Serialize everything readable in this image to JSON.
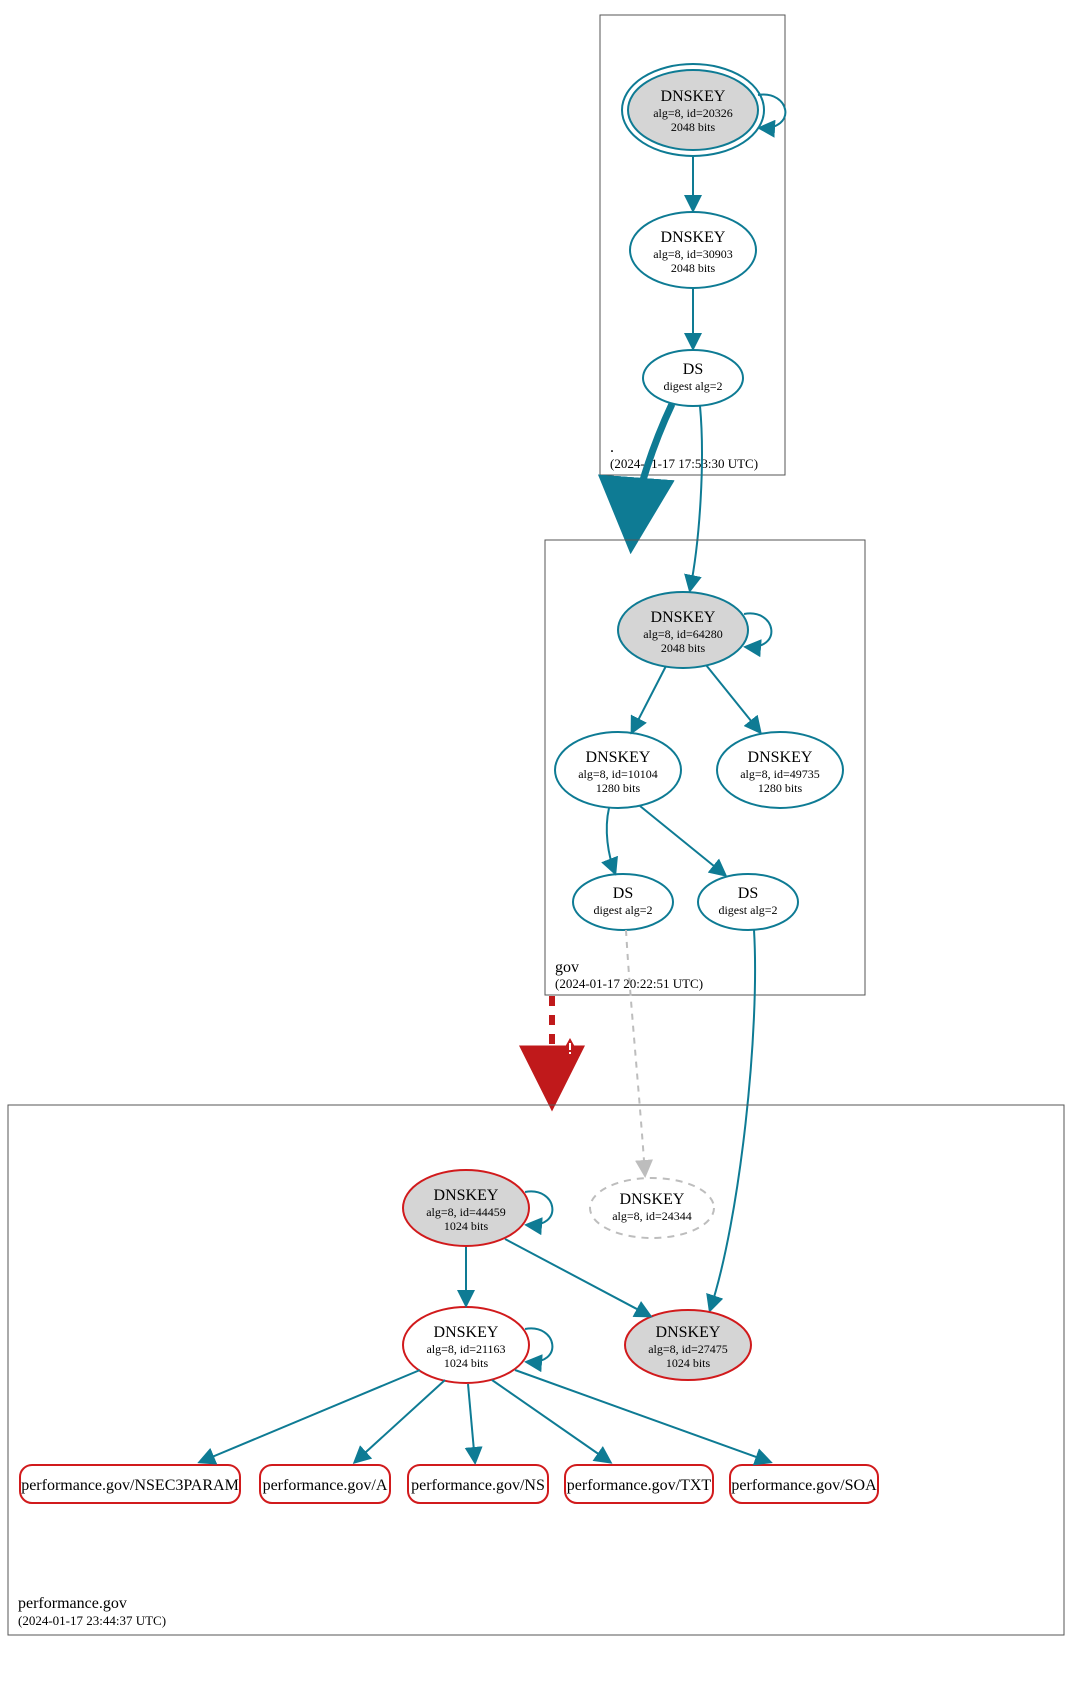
{
  "colors": {
    "teal": "#0e7b94",
    "red": "#d11a1c",
    "grayFill": "#d5d5d5",
    "boxStroke": "#555555",
    "dashedGray": "#bdbdbd"
  },
  "zones": {
    "root": {
      "name": ".",
      "timestamp": "(2024-01-17 17:53:30 UTC)"
    },
    "gov": {
      "name": "gov",
      "timestamp": "(2024-01-17 20:22:51 UTC)"
    },
    "perf": {
      "name": "performance.gov",
      "timestamp": "(2024-01-17 23:44:37 UTC)"
    }
  },
  "nodes": {
    "root_ksk": {
      "title": "DNSKEY",
      "line2": "alg=8, id=20326",
      "line3": "2048 bits"
    },
    "root_zsk": {
      "title": "DNSKEY",
      "line2": "alg=8, id=30903",
      "line3": "2048 bits"
    },
    "root_ds": {
      "title": "DS",
      "line2": "digest alg=2"
    },
    "gov_ksk": {
      "title": "DNSKEY",
      "line2": "alg=8, id=64280",
      "line3": "2048 bits"
    },
    "gov_zskL": {
      "title": "DNSKEY",
      "line2": "alg=8, id=10104",
      "line3": "1280 bits"
    },
    "gov_zskR": {
      "title": "DNSKEY",
      "line2": "alg=8, id=49735",
      "line3": "1280 bits"
    },
    "gov_dsL": {
      "title": "DS",
      "line2": "digest alg=2"
    },
    "gov_dsR": {
      "title": "DS",
      "line2": "digest alg=2"
    },
    "perf_ksk": {
      "title": "DNSKEY",
      "line2": "alg=8, id=44459",
      "line3": "1024 bits"
    },
    "perf_dash": {
      "title": "DNSKEY",
      "line2": "alg=8, id=24344"
    },
    "perf_zsk": {
      "title": "DNSKEY",
      "line2": "alg=8, id=21163",
      "line3": "1024 bits"
    },
    "perf_rev": {
      "title": "DNSKEY",
      "line2": "alg=8, id=27475",
      "line3": "1024 bits"
    },
    "rr_nsec3": {
      "title": "performance.gov/NSEC3PARAM"
    },
    "rr_a": {
      "title": "performance.gov/A"
    },
    "rr_ns": {
      "title": "performance.gov/NS"
    },
    "rr_txt": {
      "title": "performance.gov/TXT"
    },
    "rr_soa": {
      "title": "performance.gov/SOA"
    }
  }
}
